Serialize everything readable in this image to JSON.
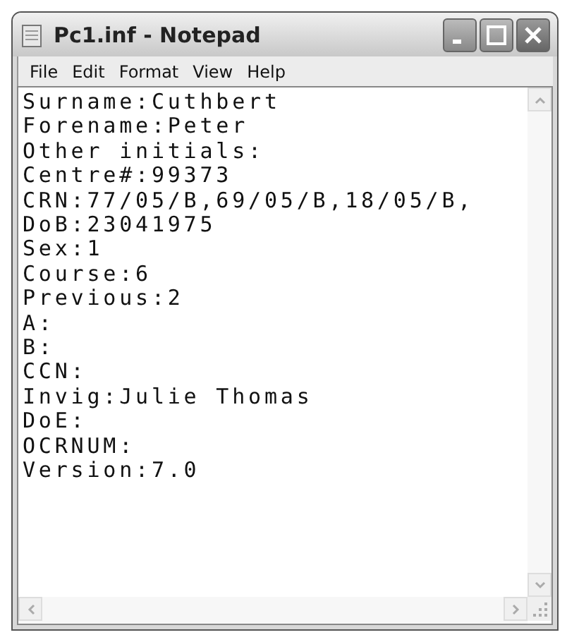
{
  "window": {
    "title": "Pc1.inf - Notepad"
  },
  "menu": [
    {
      "label": "File"
    },
    {
      "label": "Edit"
    },
    {
      "label": "Format"
    },
    {
      "label": "View"
    },
    {
      "label": "Help"
    }
  ],
  "document": {
    "lines": [
      "Surname:Cuthbert",
      "Forename:Peter",
      "Other initials:",
      "Centre#:99373",
      "CRN:77/05/B,69/05/B,18/05/B,",
      "DoB:23041975",
      "Sex:1",
      "Course:6",
      "Previous:2",
      "A:",
      "B:",
      "CCN:",
      "Invig:Julie Thomas",
      "DoE:",
      "OCRNUM:",
      "Version:7.0"
    ]
  }
}
